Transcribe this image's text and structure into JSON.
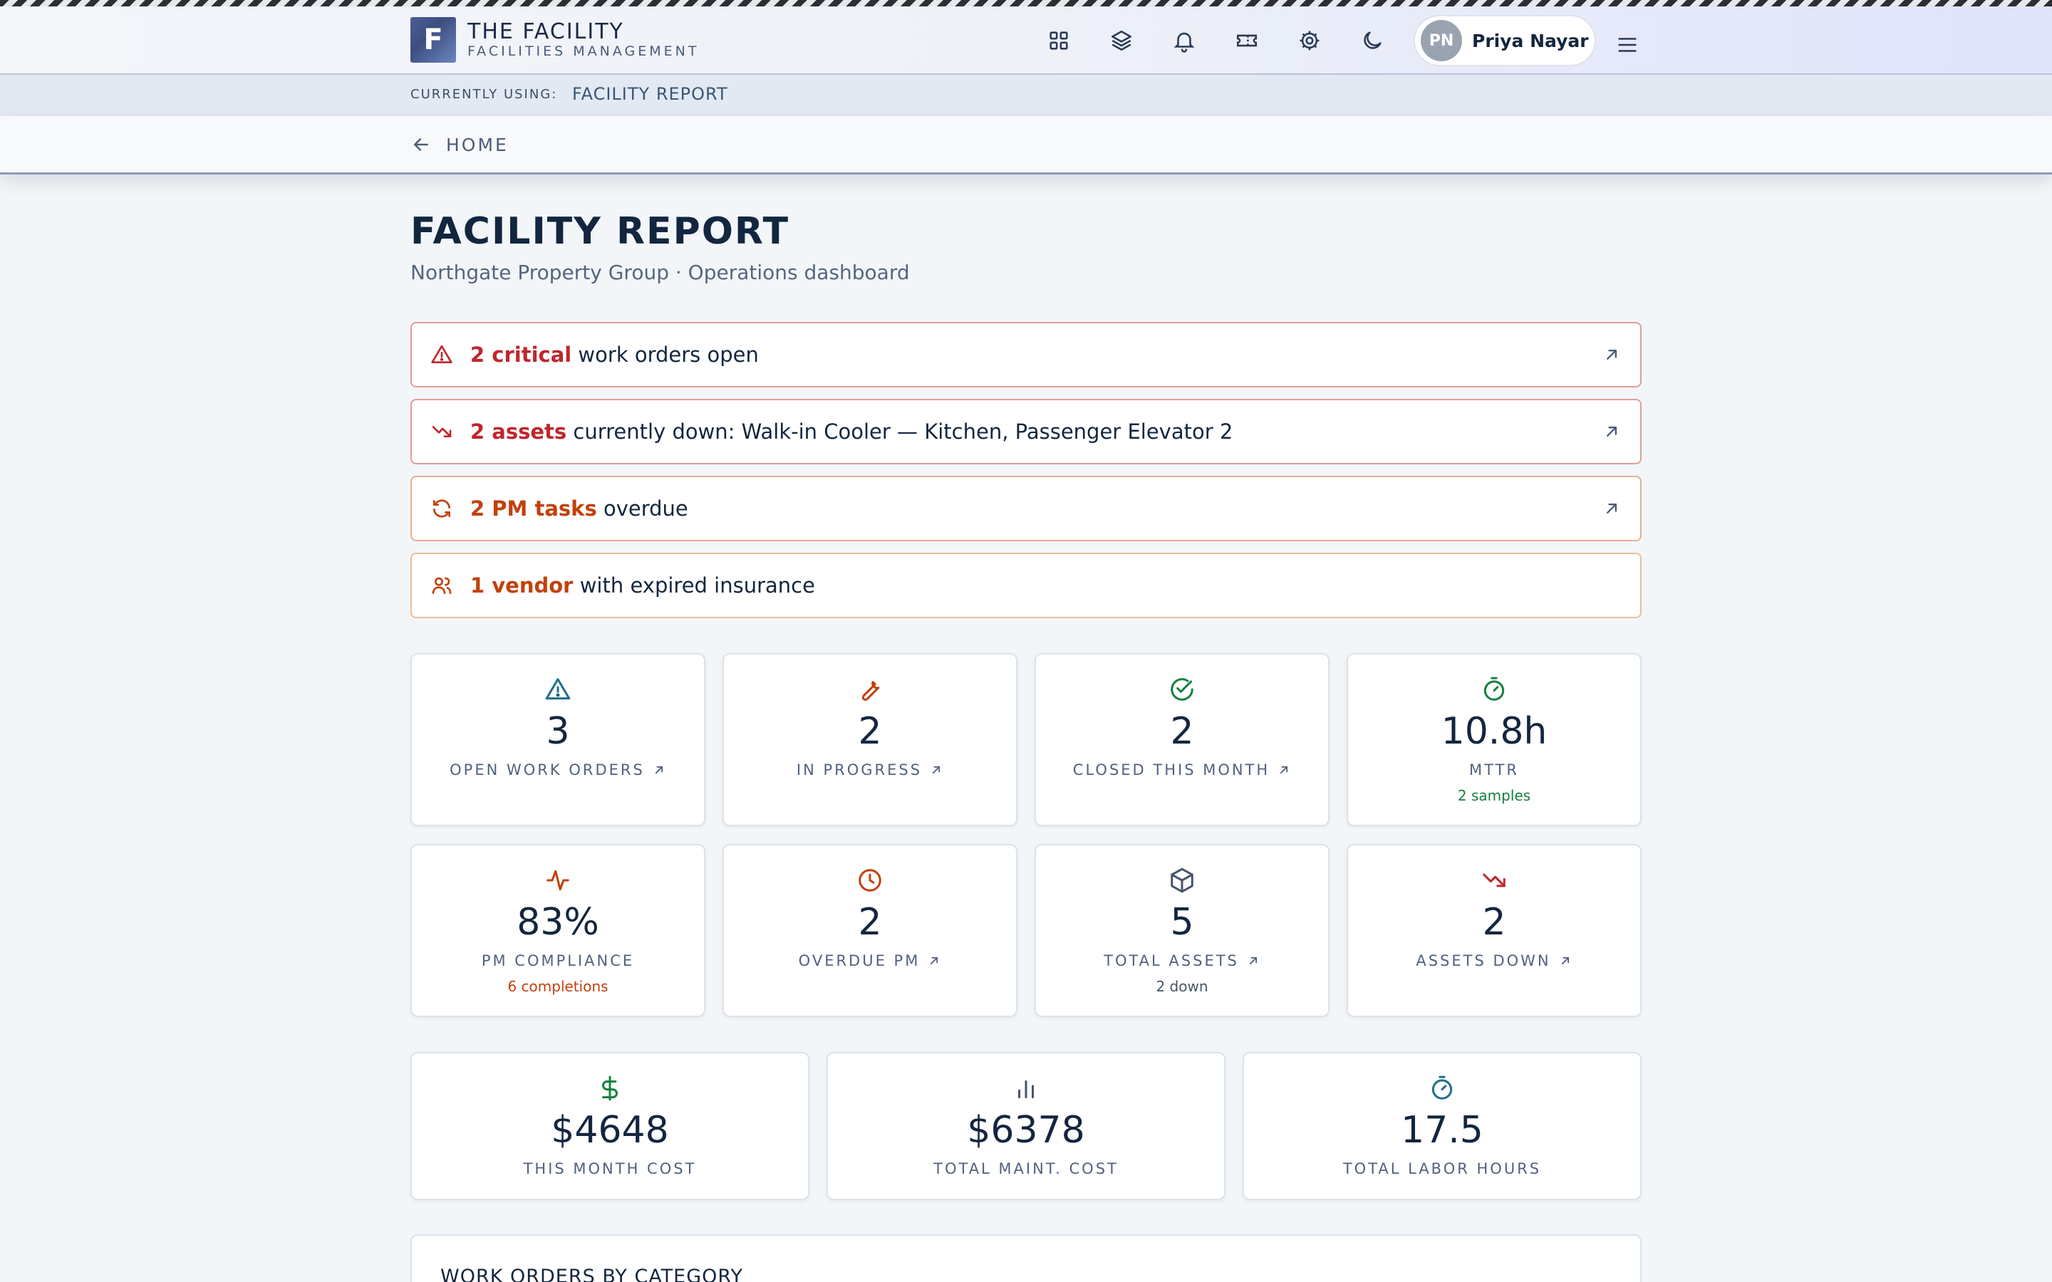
{
  "app": {
    "brand_title": "THE FACILITY",
    "brand_subtitle": "FACILITIES MANAGEMENT",
    "logo_letter": "F"
  },
  "nav_icons": [
    "apps-grid-icon",
    "layers-icon",
    "bell-icon",
    "ticket-icon",
    "gear-icon",
    "moon-icon"
  ],
  "user": {
    "initials": "PN",
    "name": "Priya Nayar"
  },
  "context_bar": {
    "label": "CURRENTLY USING:",
    "value": "FACILITY REPORT"
  },
  "back_link": {
    "label": "HOME"
  },
  "page": {
    "title": "FACILITY REPORT",
    "subtitle": "Northgate Property Group · Operations dashboard"
  },
  "alerts": [
    {
      "icon": "warning-triangle-icon",
      "strong": "2 critical",
      "text": " work orders open",
      "color": "#c0262d",
      "has_link": true
    },
    {
      "icon": "trending-down-icon",
      "strong": "2 assets",
      "text": " currently down: Walk-in Cooler — Kitchen, Passenger Elevator 2",
      "color": "#c0262d",
      "has_link": true
    },
    {
      "icon": "refresh-icon",
      "strong": "2 PM tasks",
      "text": " overdue",
      "color": "#c2410c",
      "has_link": true
    },
    {
      "icon": "users-icon",
      "strong": "1 vendor",
      "text": " with expired insurance",
      "color": "#c2410c",
      "has_link": false
    }
  ],
  "kpis_row1": [
    {
      "icon": "warning-triangle-icon",
      "value": "3",
      "label": "OPEN WORK ORDERS",
      "link": true,
      "note": ""
    },
    {
      "icon": "wrench-icon",
      "value": "2",
      "label": "IN PROGRESS",
      "link": true,
      "note": ""
    },
    {
      "icon": "check-circle-icon",
      "value": "2",
      "label": "CLOSED THIS MONTH",
      "link": true,
      "note": ""
    },
    {
      "icon": "stopwatch-icon",
      "value": "10.8h",
      "label": "MTTR",
      "link": false,
      "note": "2 samples"
    }
  ],
  "kpis_row2": [
    {
      "icon": "activity-icon",
      "value": "83%",
      "label": "PM COMPLIANCE",
      "link": false,
      "note": "6 completions"
    },
    {
      "icon": "clock-icon",
      "value": "2",
      "label": "OVERDUE PM",
      "link": true,
      "note": ""
    },
    {
      "icon": "package-icon",
      "value": "5",
      "label": "TOTAL ASSETS",
      "link": true,
      "note": "2 down"
    },
    {
      "icon": "trending-down-icon",
      "value": "2",
      "label": "ASSETS DOWN",
      "link": true,
      "note": ""
    }
  ],
  "cost_cards": [
    {
      "icon": "dollar-icon",
      "value": "$4648",
      "label": "THIS MONTH COST"
    },
    {
      "icon": "bar-chart-icon",
      "value": "$6378",
      "label": "TOTAL MAINT. COST"
    },
    {
      "icon": "stopwatch-icon",
      "value": "17.5",
      "label": "TOTAL LABOR HOURS"
    }
  ],
  "section": {
    "title": "WORK ORDERS BY CATEGORY"
  },
  "colors": {
    "critical": "#c0262d",
    "warning": "#c2410c",
    "teal": "#1f6f8b",
    "green": "#15803d",
    "slate": "#475569"
  }
}
